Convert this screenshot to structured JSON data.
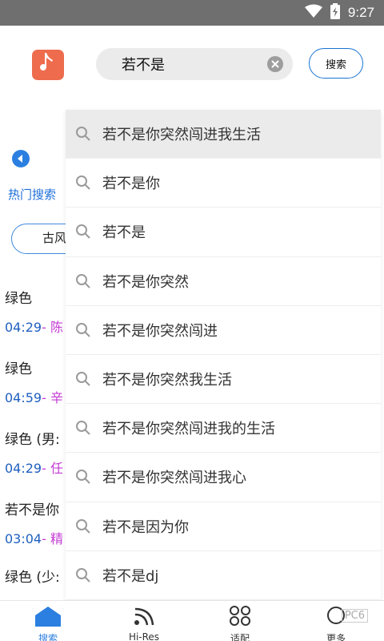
{
  "status_bar": {
    "time": "9:27",
    "icons": [
      "wifi-icon",
      "battery-icon"
    ]
  },
  "header": {
    "search_value": "若不是",
    "search_button_label": "搜索",
    "logo_icon": "music-note-icon",
    "logo_color": "#ee6c4d"
  },
  "background": {
    "hot_label": "热门搜索",
    "tag": "古风",
    "songs": [
      {
        "title": "绿色",
        "duration": "04:29",
        "artist": "- 陈"
      },
      {
        "title": "绿色",
        "duration": "04:59",
        "artist": "- 辛"
      },
      {
        "title": "绿色 (男:",
        "duration": "04:29",
        "artist": "- 任"
      },
      {
        "title": "若不是你",
        "duration": "03:04",
        "artist": "- 精"
      },
      {
        "title": "绿色 (少:",
        "duration": "",
        "artist": ""
      }
    ]
  },
  "suggestions": [
    "若不是你突然闯进我生活",
    "若不是你",
    "若不是",
    "若不是你突然",
    "若不是你突然闯进",
    "若不是你突然我生活",
    "若不是你突然闯进我的生活",
    "若不是你突然闯进我心",
    "若不是因为你",
    "若不是dj"
  ],
  "bottom_nav": [
    {
      "label": "搜索",
      "icon": "home-icon",
      "active": true
    },
    {
      "label": "Hi-Res",
      "icon": "rss-icon",
      "active": false
    },
    {
      "label": "适配",
      "icon": "grid-circles-icon",
      "active": false
    },
    {
      "label": "更多",
      "icon": "more-icon",
      "active": false
    }
  ],
  "watermark": "PC6"
}
